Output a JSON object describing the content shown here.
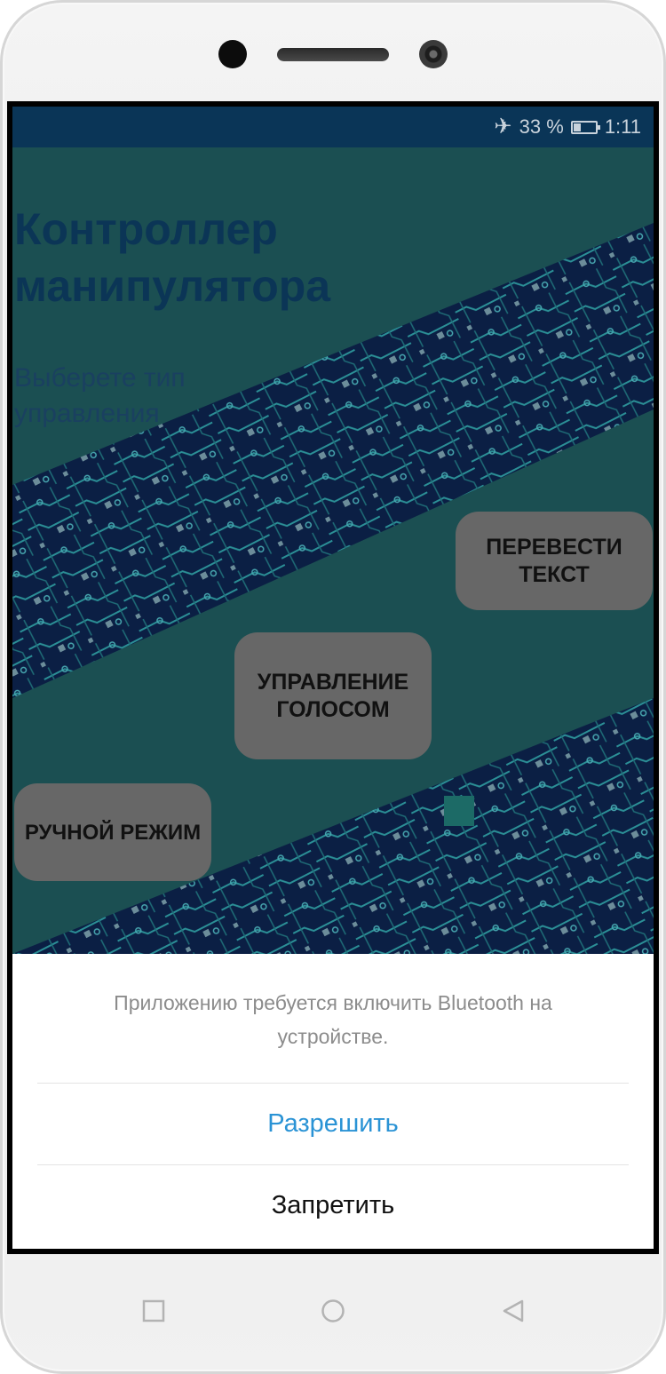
{
  "status_bar": {
    "battery_text": "33 %",
    "battery_level": 0.33,
    "time": "1:11",
    "icons": [
      "airplane-mode-icon",
      "battery-icon"
    ]
  },
  "app": {
    "title": "Контроллер манипулятора",
    "subtitle": "Выберете тип управления",
    "buttons": {
      "translate": [
        "ПЕРЕВЕСТИ",
        "ТЕКСТ"
      ],
      "voice": [
        "УПРАВЛЕНИЕ",
        "ГОЛОСОМ"
      ],
      "manual": "РУЧНОЙ РЕЖИМ"
    }
  },
  "permission_sheet": {
    "message": "Приложению требуется включить Bluetooth на устройстве.",
    "allow_label": "Разрешить",
    "deny_label": "Запретить"
  },
  "nav_bar": {
    "icons": [
      "recents-square-icon",
      "home-circle-icon",
      "back-triangle-icon"
    ]
  },
  "colors": {
    "status_bar": "#0a3557",
    "app_background": "#1b4f52",
    "circuit_band": "#0b1f44",
    "button": "#676767",
    "allow_action": "#2a93d5"
  }
}
